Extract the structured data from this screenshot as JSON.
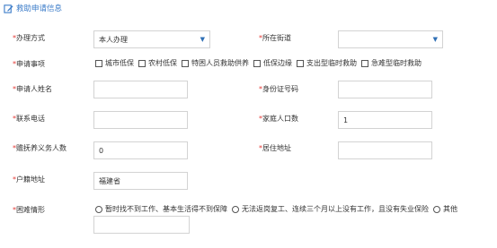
{
  "section": {
    "icon": "edit-icon",
    "title": "救助申请信息"
  },
  "colors": {
    "accent": "#3a7bc8",
    "required": "#e53935"
  },
  "form": {
    "handling_method": {
      "label": "办理方式",
      "value": "本人办理"
    },
    "street": {
      "label": "所在街道",
      "value": ""
    },
    "apply_items": {
      "label": "申请事项",
      "options": [
        "城市低保",
        "农村低保",
        "特困人员救助供养",
        "低保边缘",
        "支出型临时救助",
        "急难型临时救助"
      ]
    },
    "applicant_name": {
      "label": "申请人姓名",
      "value": ""
    },
    "id_number": {
      "label": "身份证号码",
      "value": ""
    },
    "phone": {
      "label": "联系电话",
      "value": ""
    },
    "household_size": {
      "label": "家庭人口数",
      "value": "1"
    },
    "dependents": {
      "label": "赡抚养义务人数",
      "value": "0"
    },
    "residence": {
      "label": "居住地址",
      "value": ""
    },
    "hukou": {
      "label": "户籍地址",
      "value": "福建省"
    },
    "hardship": {
      "label": "困难情形",
      "options": [
        "暂时找不到工作、基本生活得不到保障",
        "无法返岗复工、连续三个月以上没有工作，且没有失业保险",
        "其他"
      ],
      "other_value": ""
    }
  }
}
